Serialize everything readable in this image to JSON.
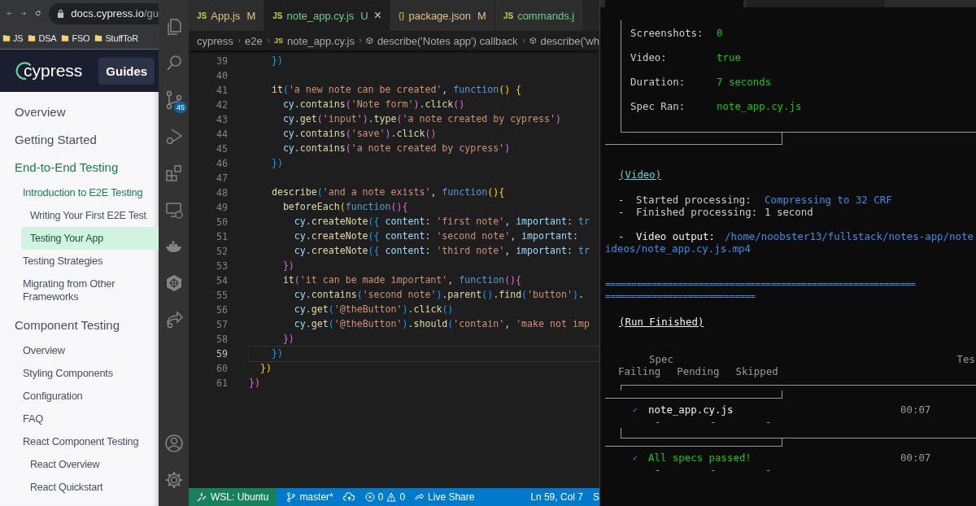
{
  "browser": {
    "url": {
      "host": "docs.cypress.io",
      "path": "/gu"
    },
    "bookmarks": [
      "JS",
      "DSA",
      "FSO",
      "StuffToR"
    ],
    "logo": "cypress",
    "header_button": "Guides",
    "nav": [
      {
        "label": "Overview",
        "selected": false
      },
      {
        "label": "Getting Started",
        "selected": false
      },
      {
        "label": "End-to-End Testing",
        "selected": false,
        "children": [
          {
            "label": "Introduction to E2E Testing",
            "selected": false,
            "children": [
              {
                "label": "Writing Your First E2E Test",
                "selected": false
              },
              {
                "label": "Testing Your App",
                "selected": true
              }
            ]
          },
          {
            "label": "Testing Strategies",
            "selected": false
          },
          {
            "label": "Migrating from Other Frameworks",
            "selected": false
          }
        ]
      },
      {
        "label": "Component Testing",
        "selected": false,
        "children": [
          {
            "label": "Overview",
            "selected": false
          },
          {
            "label": "Styling Components",
            "selected": false
          },
          {
            "label": "Configuration",
            "selected": false
          },
          {
            "label": "FAQ",
            "selected": false
          },
          {
            "label": "React Component Testing",
            "selected": false,
            "children": [
              {
                "label": "React Overview",
                "selected": false
              },
              {
                "label": "React Quickstart",
                "selected": false
              }
            ]
          }
        ]
      }
    ]
  },
  "editor": {
    "scm_badge": "45",
    "tabs": [
      {
        "icon": "JS",
        "name": "App.js",
        "status": "M",
        "color": "#e2c08d",
        "selected": false
      },
      {
        "icon": "JS",
        "name": "note_app.cy.js",
        "status": "U",
        "color": "#73c991",
        "selected": true,
        "close": "×"
      },
      {
        "icon": "{}",
        "name": "package.json",
        "status": "M",
        "color": "#e2c08d",
        "selected": false
      },
      {
        "icon": "JS",
        "name": "commands.j",
        "color": "#73c991",
        "selected": false
      }
    ],
    "breadcrumb": [
      {
        "kind": "folder",
        "text": "cypress"
      },
      {
        "kind": "folder",
        "text": "e2e"
      },
      {
        "kind": "file",
        "icon": "JS",
        "text": "note_app.cy.js"
      },
      {
        "kind": "symbol",
        "text": "describe('Notes app') callback"
      },
      {
        "kind": "symbol",
        "text": "describe('wh"
      }
    ],
    "lines": [
      {
        "number": "39",
        "current": false,
        "tokens": [
          {
            "kind": "br3",
            "text": "    })"
          }
        ]
      },
      {
        "number": "40",
        "current": false
      },
      {
        "number": "41",
        "current": false,
        "tokens": [
          {
            "kind": "fn",
            "text": "    it"
          },
          {
            "kind": "br3",
            "text": "("
          },
          {
            "kind": "str",
            "text": "'a new note can be created'"
          },
          {
            "kind": "plain",
            "text": ", "
          },
          {
            "kind": "kw",
            "text": "function"
          },
          {
            "kind": "br1",
            "text": "() {"
          }
        ]
      },
      {
        "number": "42",
        "current": false,
        "tokens": [
          {
            "kind": "var",
            "text": "      cy"
          },
          {
            "kind": "plain",
            "text": "."
          },
          {
            "kind": "fn",
            "text": "contains"
          },
          {
            "kind": "br2",
            "text": "("
          },
          {
            "kind": "str",
            "text": "'Note form'"
          },
          {
            "kind": "br2",
            "text": ")"
          },
          {
            "kind": "plain",
            "text": "."
          },
          {
            "kind": "fn",
            "text": "click"
          },
          {
            "kind": "br2",
            "text": "()"
          }
        ]
      },
      {
        "number": "43",
        "current": false,
        "tokens": [
          {
            "kind": "var",
            "text": "      cy"
          },
          {
            "kind": "plain",
            "text": "."
          },
          {
            "kind": "fn",
            "text": "get"
          },
          {
            "kind": "br2",
            "text": "("
          },
          {
            "kind": "str",
            "text": "'input'"
          },
          {
            "kind": "br2",
            "text": ")"
          },
          {
            "kind": "plain",
            "text": "."
          },
          {
            "kind": "fn",
            "text": "type"
          },
          {
            "kind": "br2",
            "text": "("
          },
          {
            "kind": "str",
            "text": "'a note created by cypress'"
          },
          {
            "kind": "br2",
            "text": ")"
          }
        ]
      },
      {
        "number": "44",
        "current": false,
        "tokens": [
          {
            "kind": "var",
            "text": "      cy"
          },
          {
            "kind": "plain",
            "text": "."
          },
          {
            "kind": "fn",
            "text": "contains"
          },
          {
            "kind": "br2",
            "text": "("
          },
          {
            "kind": "str",
            "text": "'save'"
          },
          {
            "kind": "br2",
            "text": ")"
          },
          {
            "kind": "plain",
            "text": "."
          },
          {
            "kind": "fn",
            "text": "click"
          },
          {
            "kind": "br2",
            "text": "()"
          }
        ]
      },
      {
        "number": "45",
        "current": false,
        "tokens": [
          {
            "kind": "var",
            "text": "      cy"
          },
          {
            "kind": "plain",
            "text": "."
          },
          {
            "kind": "fn",
            "text": "contains"
          },
          {
            "kind": "br2",
            "text": "("
          },
          {
            "kind": "str",
            "text": "'a note created by cypress'"
          },
          {
            "kind": "br2",
            "text": ")"
          }
        ]
      },
      {
        "number": "46",
        "current": false,
        "tokens": [
          {
            "kind": "br3",
            "text": "    })"
          }
        ]
      },
      {
        "number": "47",
        "current": false
      },
      {
        "number": "48",
        "current": false,
        "tokens": [
          {
            "kind": "fn",
            "text": "    describe"
          },
          {
            "kind": "br3",
            "text": "("
          },
          {
            "kind": "str",
            "text": "'and a note exists'"
          },
          {
            "kind": "plain",
            "text": ", "
          },
          {
            "kind": "kw",
            "text": "function"
          },
          {
            "kind": "br1",
            "text": "(){"
          }
        ]
      },
      {
        "number": "49",
        "current": false,
        "tokens": [
          {
            "kind": "fn",
            "text": "      beforeEach"
          },
          {
            "kind": "br1",
            "text": "("
          },
          {
            "kind": "kw",
            "text": "function"
          },
          {
            "kind": "br2",
            "text": "(){"
          }
        ]
      },
      {
        "number": "50",
        "current": false,
        "tokens": [
          {
            "kind": "var",
            "text": "        cy"
          },
          {
            "kind": "plain",
            "text": "."
          },
          {
            "kind": "fn",
            "text": "createNote"
          },
          {
            "kind": "br3",
            "text": "({"
          },
          {
            "kind": "var",
            "text": " content"
          },
          {
            "kind": "plain",
            "text": ": "
          },
          {
            "kind": "str",
            "text": "'first note'"
          },
          {
            "kind": "plain",
            "text": ", "
          },
          {
            "kind": "var",
            "text": "important"
          },
          {
            "kind": "plain",
            "text": ": "
          },
          {
            "kind": "kw",
            "text": "tr"
          }
        ]
      },
      {
        "number": "51",
        "current": false,
        "tokens": [
          {
            "kind": "var",
            "text": "        cy"
          },
          {
            "kind": "plain",
            "text": "."
          },
          {
            "kind": "fn",
            "text": "createNote"
          },
          {
            "kind": "br3",
            "text": "({"
          },
          {
            "kind": "var",
            "text": " content"
          },
          {
            "kind": "plain",
            "text": ": "
          },
          {
            "kind": "str",
            "text": "'second note'"
          },
          {
            "kind": "plain",
            "text": ", "
          },
          {
            "kind": "var",
            "text": "important"
          },
          {
            "kind": "plain",
            "text": ":"
          }
        ]
      },
      {
        "number": "52",
        "current": false,
        "tokens": [
          {
            "kind": "var",
            "text": "        cy"
          },
          {
            "kind": "plain",
            "text": "."
          },
          {
            "kind": "fn",
            "text": "createNote"
          },
          {
            "kind": "br3",
            "text": "({"
          },
          {
            "kind": "var",
            "text": " content"
          },
          {
            "kind": "plain",
            "text": ": "
          },
          {
            "kind": "str",
            "text": "'third note'"
          },
          {
            "kind": "plain",
            "text": ", "
          },
          {
            "kind": "var",
            "text": "important"
          },
          {
            "kind": "plain",
            "text": ": "
          },
          {
            "kind": "kw",
            "text": "tr"
          }
        ]
      },
      {
        "number": "53",
        "current": false,
        "tokens": [
          {
            "kind": "br2",
            "text": "      })"
          }
        ]
      },
      {
        "number": "54",
        "current": false,
        "tokens": [
          {
            "kind": "fn",
            "text": "      it"
          },
          {
            "kind": "br2",
            "text": "("
          },
          {
            "kind": "str",
            "text": "'it can be made important'"
          },
          {
            "kind": "plain",
            "text": ", "
          },
          {
            "kind": "kw",
            "text": "function"
          },
          {
            "kind": "br2",
            "text": "(){"
          }
        ]
      },
      {
        "number": "55",
        "current": false,
        "tokens": [
          {
            "kind": "var",
            "text": "        cy"
          },
          {
            "kind": "plain",
            "text": "."
          },
          {
            "kind": "fn",
            "text": "contains"
          },
          {
            "kind": "br3",
            "text": "("
          },
          {
            "kind": "str",
            "text": "'second note'"
          },
          {
            "kind": "br3",
            "text": ")"
          },
          {
            "kind": "plain",
            "text": "."
          },
          {
            "kind": "fn",
            "text": "parent"
          },
          {
            "kind": "br3",
            "text": "()"
          },
          {
            "kind": "plain",
            "text": "."
          },
          {
            "kind": "fn",
            "text": "find"
          },
          {
            "kind": "br3",
            "text": "("
          },
          {
            "kind": "str",
            "text": "'button'"
          },
          {
            "kind": "br3",
            "text": ")"
          },
          {
            "kind": "plain",
            "text": "."
          }
        ]
      },
      {
        "number": "56",
        "current": false,
        "tokens": [
          {
            "kind": "var",
            "text": "        cy"
          },
          {
            "kind": "plain",
            "text": "."
          },
          {
            "kind": "fn",
            "text": "get"
          },
          {
            "kind": "br3",
            "text": "("
          },
          {
            "kind": "str",
            "text": "'@theButton'"
          },
          {
            "kind": "br3",
            "text": ")"
          },
          {
            "kind": "plain",
            "text": "."
          },
          {
            "kind": "fn",
            "text": "click"
          },
          {
            "kind": "br3",
            "text": "()"
          }
        ]
      },
      {
        "number": "57",
        "current": false,
        "tokens": [
          {
            "kind": "var",
            "text": "        cy"
          },
          {
            "kind": "plain",
            "text": "."
          },
          {
            "kind": "fn",
            "text": "get"
          },
          {
            "kind": "br3",
            "text": "("
          },
          {
            "kind": "str",
            "text": "'@theButton'"
          },
          {
            "kind": "br3",
            "text": ")"
          },
          {
            "kind": "plain",
            "text": "."
          },
          {
            "kind": "fn",
            "text": "should"
          },
          {
            "kind": "br3",
            "text": "("
          },
          {
            "kind": "str",
            "text": "'contain'"
          },
          {
            "kind": "plain",
            "text": ", "
          },
          {
            "kind": "str",
            "text": "'make not imp"
          }
        ]
      },
      {
        "number": "58",
        "current": false,
        "tokens": [
          {
            "kind": "br2",
            "text": "      })"
          }
        ]
      },
      {
        "number": "59",
        "current": true,
        "tokens": [
          {
            "kind": "br3",
            "text": "    })"
          }
        ]
      },
      {
        "number": "60",
        "current": false,
        "tokens": [
          {
            "kind": "br1",
            "text": "  })"
          }
        ]
      },
      {
        "number": "61",
        "current": false,
        "tokens": [
          {
            "kind": "br2",
            "text": "})"
          }
        ]
      }
    ],
    "status_bar": {
      "remote": "WSL: Ubuntu",
      "branch": "master*",
      "errors": "0",
      "warnings": "0",
      "live_share": "Live Share",
      "position": "Ln 59, Col 7",
      "cut_item": "S"
    }
  },
  "terminal": {
    "summary": [
      {
        "label": "Screenshots:",
        "value": "0"
      },
      {
        "label": "Video:",
        "value": "true"
      },
      {
        "label": "Duration:",
        "value": "7 seconds"
      },
      {
        "label": "Spec Ran:",
        "value": "note_app.cy.js"
      }
    ],
    "video_heading": "(Video)",
    "processing": [
      {
        "dash": "-",
        "label": "Started processing:",
        "value": "Compressing to 32 CRF",
        "kind": "highlight"
      },
      {
        "dash": "-",
        "label": "Finished processing:",
        "value": "1 second",
        "kind": "plain"
      }
    ],
    "video_output": {
      "dash": "-",
      "label": "Video output:",
      "path": [
        "/home/noobster13/fullstack/notes-app/note",
        "ideos/note_app.cy.js.mp4"
      ]
    },
    "separator": [
      "============================================================",
      "============================="
    ],
    "run_finished": "(Run Finished)",
    "header": {
      "line_1": [
        "Spec",
        "Tes"
      ],
      "line_2": [
        "Failing",
        "Pending",
        "Skipped"
      ]
    },
    "rows": [
      {
        "kind": "spec",
        "check": "✓",
        "name": "note_app.cy.js",
        "time": "00:07",
        "counts": [
          "-",
          "-",
          "-"
        ]
      },
      {
        "kind": "total",
        "check": "✓",
        "name": "All specs passed!",
        "time": "00:07",
        "counts": [
          "-",
          "-",
          "-"
        ]
      }
    ]
  }
}
